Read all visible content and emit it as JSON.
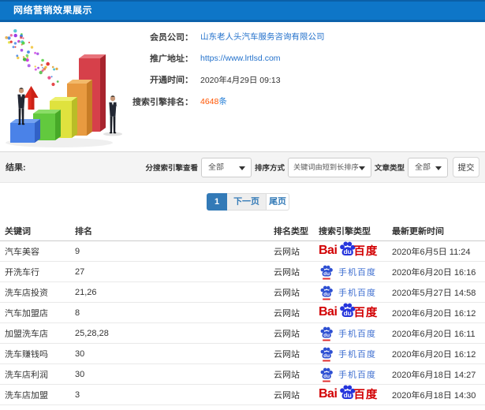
{
  "title": "网络营销效果展示",
  "info": {
    "rows": [
      {
        "label": "会员公司：",
        "value": "山东老人头汽车服务咨询有限公司"
      },
      {
        "label": "推广地址：",
        "value": "https://www.lrtlsd.com"
      },
      {
        "label": "开通时间：",
        "value": "2020年4月29日 09:13"
      },
      {
        "label": "搜索引擎排名：",
        "value": "4648",
        "suffix": "条"
      }
    ]
  },
  "illustration": {
    "description": "3D bar chart clipart: five rising bars (blue, green, yellow, orange, red), red growth arrow, confetti, two businessmen figures"
  },
  "filters": {
    "section_label": "结果:",
    "engine_label": "分搜索引擎查看",
    "engine_value": "全部",
    "sort_label": "排序方式",
    "sort_value": "关键词由短到长排序",
    "article_label": "文章类型",
    "article_value": "全部",
    "submit_label": "提交"
  },
  "pagination": {
    "current": "1",
    "next_label": "下一页",
    "last_label": "尾页"
  },
  "table": {
    "headers": [
      "关键词",
      "排名",
      "排名类型",
      "搜索引擎类型",
      "最新更新时间"
    ],
    "rows": [
      {
        "keyword": "汽车美容",
        "rank": "9",
        "rank_type": "云网站",
        "engine": "baidu",
        "updated": "2020年6月5日 11:24"
      },
      {
        "keyword": "开洗车行",
        "rank": "27",
        "rank_type": "云网站",
        "engine": "shouji_baidu",
        "updated": "2020年6月20日 16:16"
      },
      {
        "keyword": "洗车店投资",
        "rank": "21,26",
        "rank_type": "云网站",
        "engine": "shouji_baidu",
        "updated": "2020年5月27日 14:58"
      },
      {
        "keyword": "汽车加盟店",
        "rank": "8",
        "rank_type": "云网站",
        "engine": "baidu",
        "updated": "2020年6月20日 16:12"
      },
      {
        "keyword": "加盟洗车店",
        "rank": "25,28,28",
        "rank_type": "云网站",
        "engine": "shouji_baidu",
        "updated": "2020年6月20日 16:11"
      },
      {
        "keyword": "洗车赚钱吗",
        "rank": "30",
        "rank_type": "云网站",
        "engine": "shouji_baidu",
        "updated": "2020年6月20日 16:12"
      },
      {
        "keyword": "洗车店利润",
        "rank": "30",
        "rank_type": "云网站",
        "engine": "shouji_baidu",
        "updated": "2020年6月18日 14:27"
      },
      {
        "keyword": "洗车店加盟",
        "rank": "3",
        "rank_type": "云网站",
        "engine": "baidu",
        "updated": "2020年6月18日 14:30"
      }
    ]
  },
  "engines": {
    "baidu": {
      "bai": "Bai",
      "du": "du",
      "cn": "百度"
    },
    "shouji_baidu": {
      "du": "du",
      "label": "手机百度"
    }
  },
  "colors": {
    "topbar_blue": "#0e76c8",
    "link_blue": "#2472cc",
    "count_orange": "#ff5400",
    "pager_active_blue": "#337ab7",
    "baidu_red": "#d20003",
    "baidu_blue": "#2534dc",
    "bar_colors": [
      "#4a82e8",
      "#62c93e",
      "#dfe23e",
      "#e89a40",
      "#d6404a"
    ]
  }
}
